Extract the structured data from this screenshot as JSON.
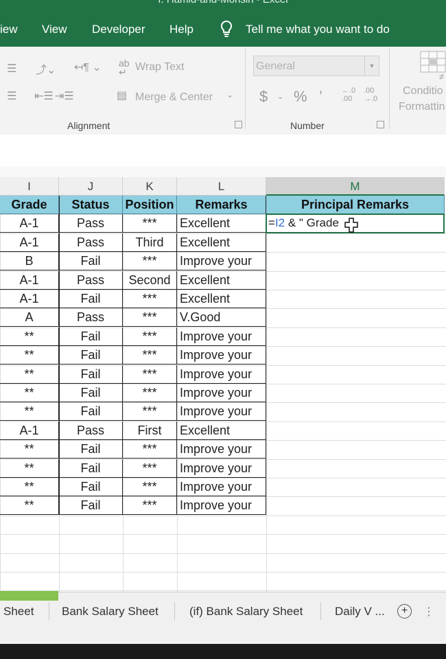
{
  "app": {
    "title": "f. Hamid-and-Mohsin  -  Excel"
  },
  "menu": {
    "tabs": [
      "iew",
      "View",
      "Developer",
      "Help"
    ],
    "tellme": "Tell me what you want to do"
  },
  "ribbon": {
    "wrap_text": "Wrap Text",
    "merge_center": "Merge & Center",
    "alignment_label": "Alignment",
    "number_format": "General",
    "currency": "$",
    "percent": "%",
    "comma": "’",
    "inc_decimal": "←.0\n.00",
    "dec_decimal": ".00\n→.0",
    "number_label": "Number",
    "conditional": "Conditio",
    "formatting": "Formattin"
  },
  "grid": {
    "column_letters": [
      "I",
      "J",
      "K",
      "L",
      "M"
    ],
    "headers": [
      "Grade",
      "Status",
      "Position",
      "Remarks",
      "Principal Remarks"
    ],
    "rows": [
      [
        "A-1",
        "Pass",
        "***",
        "Excellent"
      ],
      [
        "A-1",
        "Pass",
        "Third",
        "Excellent"
      ],
      [
        "B",
        "Fail",
        "***",
        "Improve your"
      ],
      [
        "A-1",
        "Pass",
        "Second",
        "Excellent"
      ],
      [
        "A-1",
        "Fail",
        "***",
        "Excellent"
      ],
      [
        "A",
        "Pass",
        "***",
        "V.Good"
      ],
      [
        "**",
        "Fail",
        "***",
        "Improve your"
      ],
      [
        "**",
        "Fail",
        "***",
        "Improve your"
      ],
      [
        "**",
        "Fail",
        "***",
        "Improve your"
      ],
      [
        "**",
        "Fail",
        "***",
        "Improve your"
      ],
      [
        "**",
        "Fail",
        "***",
        "Improve your"
      ],
      [
        "A-1",
        "Pass",
        "First",
        "Excellent"
      ],
      [
        "**",
        "Fail",
        "***",
        "Improve your"
      ],
      [
        "**",
        "Fail",
        "***",
        "Improve your"
      ],
      [
        "**",
        "Fail",
        "***",
        "Improve your"
      ],
      [
        "**",
        "Fail",
        "***",
        "Improve your"
      ]
    ],
    "active_formula": {
      "prefix": "=",
      "ref": "I2",
      "rest": " & \" Grade"
    }
  },
  "sheets": {
    "tabs": [
      "Sheet",
      "Bank Salary Sheet",
      "(if) Bank Salary Sheet",
      "Daily V ..."
    ],
    "add": "+",
    "more": "⋮"
  },
  "colors": {
    "excel_green": "#217346",
    "header_fill": "#8ecfe0",
    "reference_blue": "#2f6fd1",
    "tab_accent": "#86c24f"
  }
}
